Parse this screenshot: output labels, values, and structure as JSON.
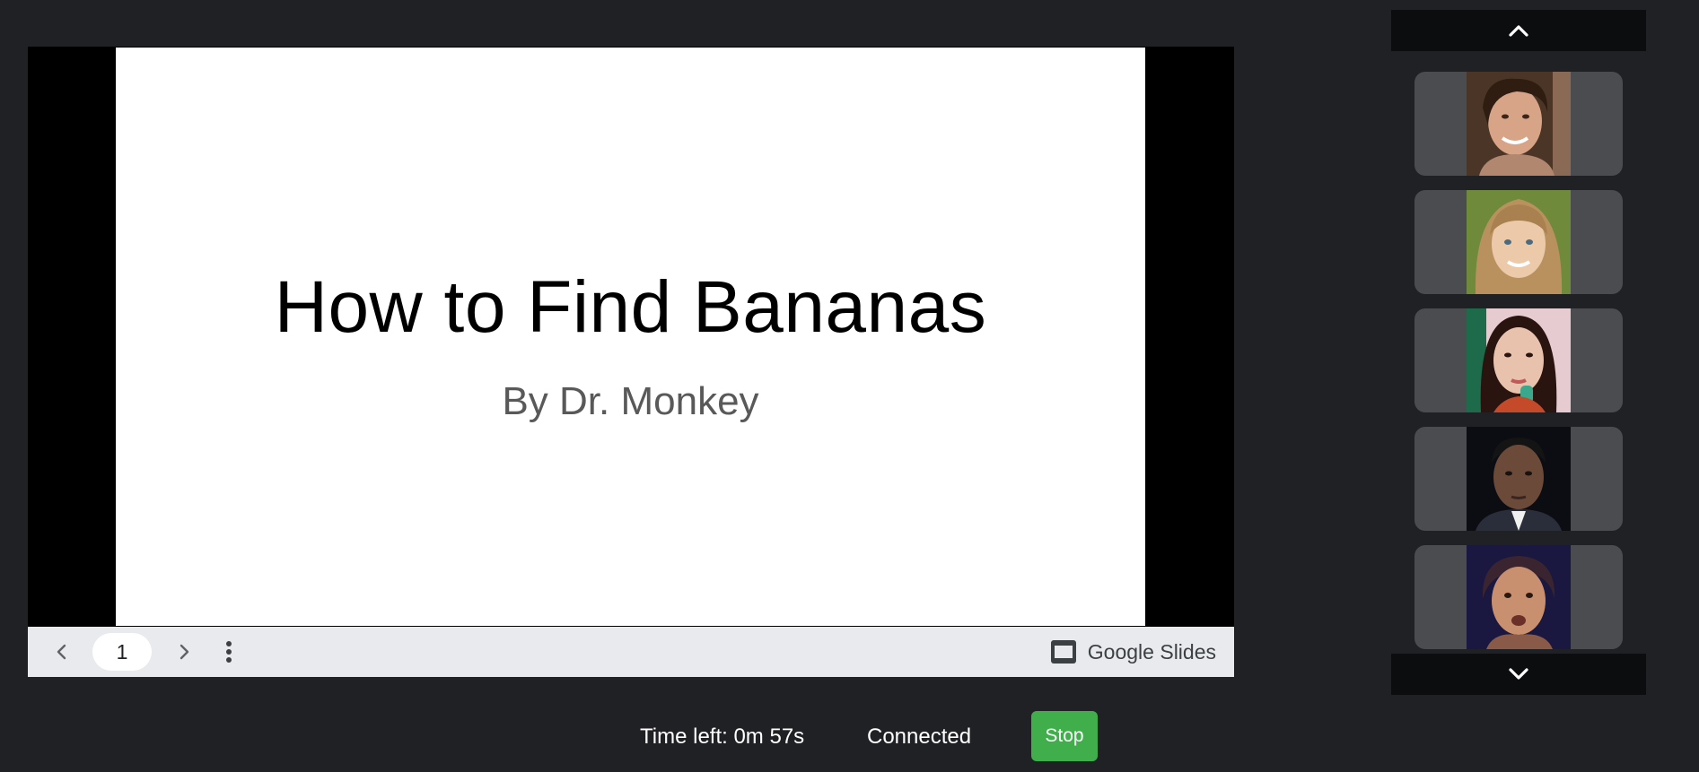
{
  "slide": {
    "title": "How to Find Bananas",
    "subtitle": "By Dr. Monkey"
  },
  "controls": {
    "page_number": "1",
    "brand_label": "Google Slides",
    "prev_icon": "chevron-left-icon",
    "next_icon": "chevron-right-icon",
    "menu_icon": "more-vert-icon"
  },
  "participants": [
    {
      "name": "participant-1",
      "palette": [
        "#3b2a1e",
        "#d8a88a",
        "#5a3a26",
        "#c48f72"
      ]
    },
    {
      "name": "participant-2",
      "palette": [
        "#6f8a3a",
        "#e8c8a8",
        "#b08a50",
        "#d8b090"
      ]
    },
    {
      "name": "participant-3",
      "palette": [
        "#1d6b4a",
        "#e7c3b0",
        "#2a1410",
        "#c98b78"
      ]
    },
    {
      "name": "participant-4",
      "palette": [
        "#0c0d12",
        "#6b4a3a",
        "#1a1a1a",
        "#3a2a22"
      ]
    },
    {
      "name": "participant-5",
      "palette": [
        "#1a1740",
        "#c8906e",
        "#3a2430",
        "#a86a50"
      ]
    }
  ],
  "status": {
    "time_left": "Time left: 0m 57s",
    "connection": "Connected",
    "stop_label": "Stop"
  },
  "colors": {
    "background": "#202124",
    "stop_button": "#3fae4b",
    "controls_bar": "#e8eaed"
  }
}
